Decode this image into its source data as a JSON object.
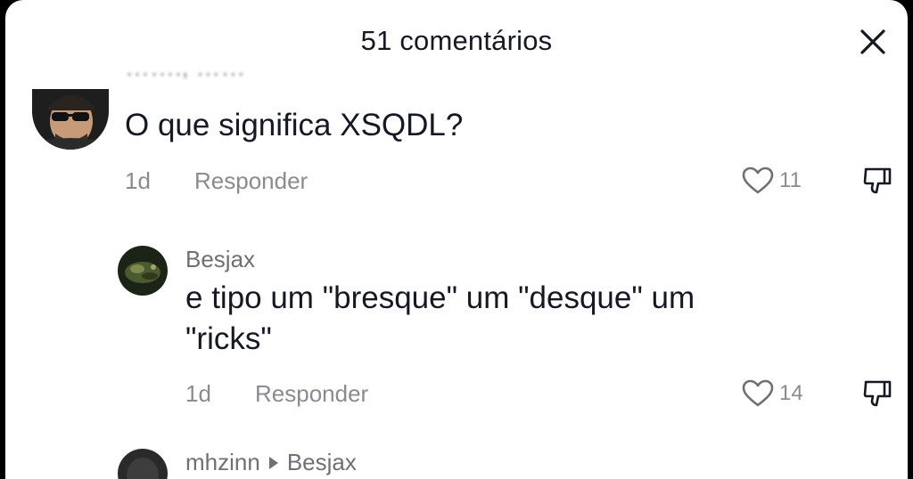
{
  "header": {
    "title": "51 comentários"
  },
  "comments": [
    {
      "text": "O que significa XSQDL?",
      "time": "1d",
      "reply_label": "Responder",
      "likes": "11"
    },
    {
      "username": "Besjax",
      "text_line1": "e tipo um \"bresque\" um \"desque\" um",
      "text_line2": "\"ricks\"",
      "time": "1d",
      "reply_label": "Responder",
      "likes": "14"
    },
    {
      "username": "mhzinn",
      "reply_to": "Besjax"
    }
  ]
}
